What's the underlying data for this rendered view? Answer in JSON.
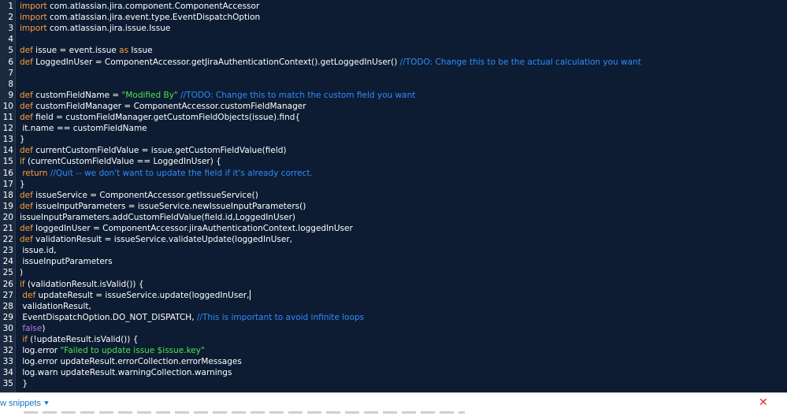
{
  "colors": {
    "background": "#0d1c32",
    "gutter": "#1c2a3f",
    "default_text": "#ffffff",
    "keyword": "#ff9e3b",
    "string": "#4ee24e",
    "comment": "#2f8cff",
    "boolean": "#b57ae6"
  },
  "editor": {
    "lines": [
      {
        "num": "1",
        "tokens": [
          {
            "t": "kw",
            "v": "import"
          },
          {
            "t": "tx",
            "v": " com.atlassian.jira.component.ComponentAccessor"
          }
        ]
      },
      {
        "num": "2",
        "tokens": [
          {
            "t": "kw",
            "v": "import"
          },
          {
            "t": "tx",
            "v": " com.atlassian.jira.event.type.EventDispatchOption"
          }
        ]
      },
      {
        "num": "3",
        "tokens": [
          {
            "t": "kw",
            "v": "import"
          },
          {
            "t": "tx",
            "v": " com.atlassian.jira.issue.Issue"
          }
        ]
      },
      {
        "num": "4",
        "tokens": []
      },
      {
        "num": "5",
        "tokens": [
          {
            "t": "kw",
            "v": "def"
          },
          {
            "t": "tx",
            "v": " issue = event.issue "
          },
          {
            "t": "kw",
            "v": "as"
          },
          {
            "t": "tx",
            "v": " Issue"
          }
        ]
      },
      {
        "num": "6",
        "tokens": [
          {
            "t": "kw",
            "v": "def"
          },
          {
            "t": "tx",
            "v": " LoggedInUser = ComponentAccessor.getJiraAuthenticationContext().getLoggedInUser() "
          },
          {
            "t": "cm",
            "v": "//TODO: Change this to be the actual calculation you want"
          }
        ]
      },
      {
        "num": "7",
        "tokens": []
      },
      {
        "num": "8",
        "tokens": []
      },
      {
        "num": "9",
        "tokens": [
          {
            "t": "kw",
            "v": "def"
          },
          {
            "t": "tx",
            "v": " customFieldName = "
          },
          {
            "t": "st",
            "v": "\"Modified By\""
          },
          {
            "t": "tx",
            "v": " "
          },
          {
            "t": "cm",
            "v": "//TODO: Change this to match the custom field you want"
          }
        ]
      },
      {
        "num": "10",
        "tokens": [
          {
            "t": "kw",
            "v": "def"
          },
          {
            "t": "tx",
            "v": " customFieldManager = ComponentAccessor.customFieldManager"
          }
        ]
      },
      {
        "num": "11",
        "tokens": [
          {
            "t": "kw",
            "v": "def"
          },
          {
            "t": "tx",
            "v": " field = customFieldManager.getCustomFieldObjects(issue).find{"
          }
        ]
      },
      {
        "num": "12",
        "tokens": [
          {
            "t": "tx",
            "v": " it.name == customFieldName"
          }
        ]
      },
      {
        "num": "13",
        "tokens": [
          {
            "t": "tx",
            "v": "}"
          }
        ]
      },
      {
        "num": "14",
        "tokens": [
          {
            "t": "kw",
            "v": "def"
          },
          {
            "t": "tx",
            "v": " currentCustomFieldValue = issue.getCustomFieldValue(field)"
          }
        ]
      },
      {
        "num": "15",
        "tokens": [
          {
            "t": "kw",
            "v": "if"
          },
          {
            "t": "tx",
            "v": " (currentCustomFieldValue == LoggedInUser) {"
          }
        ]
      },
      {
        "num": "16",
        "tokens": [
          {
            "t": "tx",
            "v": " "
          },
          {
            "t": "kw",
            "v": "return"
          },
          {
            "t": "tx",
            "v": " "
          },
          {
            "t": "cm",
            "v": "//Quit -- we don't want to update the field if it's already correct."
          }
        ]
      },
      {
        "num": "17",
        "tokens": [
          {
            "t": "tx",
            "v": "}"
          }
        ]
      },
      {
        "num": "18",
        "tokens": [
          {
            "t": "kw",
            "v": "def"
          },
          {
            "t": "tx",
            "v": " issueService = ComponentAccessor.getIssueService()"
          }
        ]
      },
      {
        "num": "19",
        "tokens": [
          {
            "t": "kw",
            "v": "def"
          },
          {
            "t": "tx",
            "v": " issueInputParameters = issueService.newIssueInputParameters()"
          }
        ]
      },
      {
        "num": "20",
        "tokens": [
          {
            "t": "tx",
            "v": "issueInputParameters.addCustomFieldValue(field.id,LoggedInUser)"
          }
        ]
      },
      {
        "num": "21",
        "tokens": [
          {
            "t": "kw",
            "v": "def"
          },
          {
            "t": "tx",
            "v": " loggedInUser = ComponentAccessor.jiraAuthenticationContext.loggedInUser"
          }
        ]
      },
      {
        "num": "22",
        "tokens": [
          {
            "t": "kw",
            "v": "def"
          },
          {
            "t": "tx",
            "v": " validationResult = issueService.validateUpdate(loggedInUser,"
          }
        ]
      },
      {
        "num": "23",
        "tokens": [
          {
            "t": "tx",
            "v": " issue.id,"
          }
        ]
      },
      {
        "num": "24",
        "tokens": [
          {
            "t": "tx",
            "v": " issueInputParameters"
          }
        ]
      },
      {
        "num": "25",
        "tokens": [
          {
            "t": "tx",
            "v": ")"
          }
        ]
      },
      {
        "num": "26",
        "tokens": [
          {
            "t": "kw",
            "v": "if"
          },
          {
            "t": "tx",
            "v": " (validationResult.isValid()) {"
          }
        ]
      },
      {
        "num": "27",
        "tokens": [
          {
            "t": "tx",
            "v": " "
          },
          {
            "t": "kw",
            "v": "def"
          },
          {
            "t": "tx",
            "v": " updateResult = issueService.update(loggedInUser,"
          }
        ],
        "cursor": true
      },
      {
        "num": "28",
        "tokens": [
          {
            "t": "tx",
            "v": " validationResult,"
          }
        ]
      },
      {
        "num": "29",
        "tokens": [
          {
            "t": "tx",
            "v": " EventDispatchOption.DO_NOT_DISPATCH, "
          },
          {
            "t": "cm",
            "v": "//This is important to avoid infinite loops"
          }
        ]
      },
      {
        "num": "30",
        "tokens": [
          {
            "t": "tx",
            "v": " "
          },
          {
            "t": "bo",
            "v": "false"
          },
          {
            "t": "tx",
            "v": ")"
          }
        ]
      },
      {
        "num": "31",
        "tokens": [
          {
            "t": "tx",
            "v": " "
          },
          {
            "t": "kw",
            "v": "if"
          },
          {
            "t": "tx",
            "v": " (!updateResult.isValid()) {"
          }
        ]
      },
      {
        "num": "32",
        "tokens": [
          {
            "t": "tx",
            "v": " log.error "
          },
          {
            "t": "st",
            "v": "\"Failed to update issue $issue.key\""
          }
        ]
      },
      {
        "num": "33",
        "tokens": [
          {
            "t": "tx",
            "v": " log.error updateResult.errorCollection.errorMessages"
          }
        ]
      },
      {
        "num": "34",
        "tokens": [
          {
            "t": "tx",
            "v": " log.warn updateResult.warningCollection.warnings"
          }
        ]
      },
      {
        "num": "35",
        "tokens": [
          {
            "t": "tx",
            "v": " }"
          }
        ]
      }
    ]
  },
  "footer": {
    "label": "w snippets",
    "chevron_icon": "double-chevron-down-icon",
    "close_icon": "close-icon"
  }
}
